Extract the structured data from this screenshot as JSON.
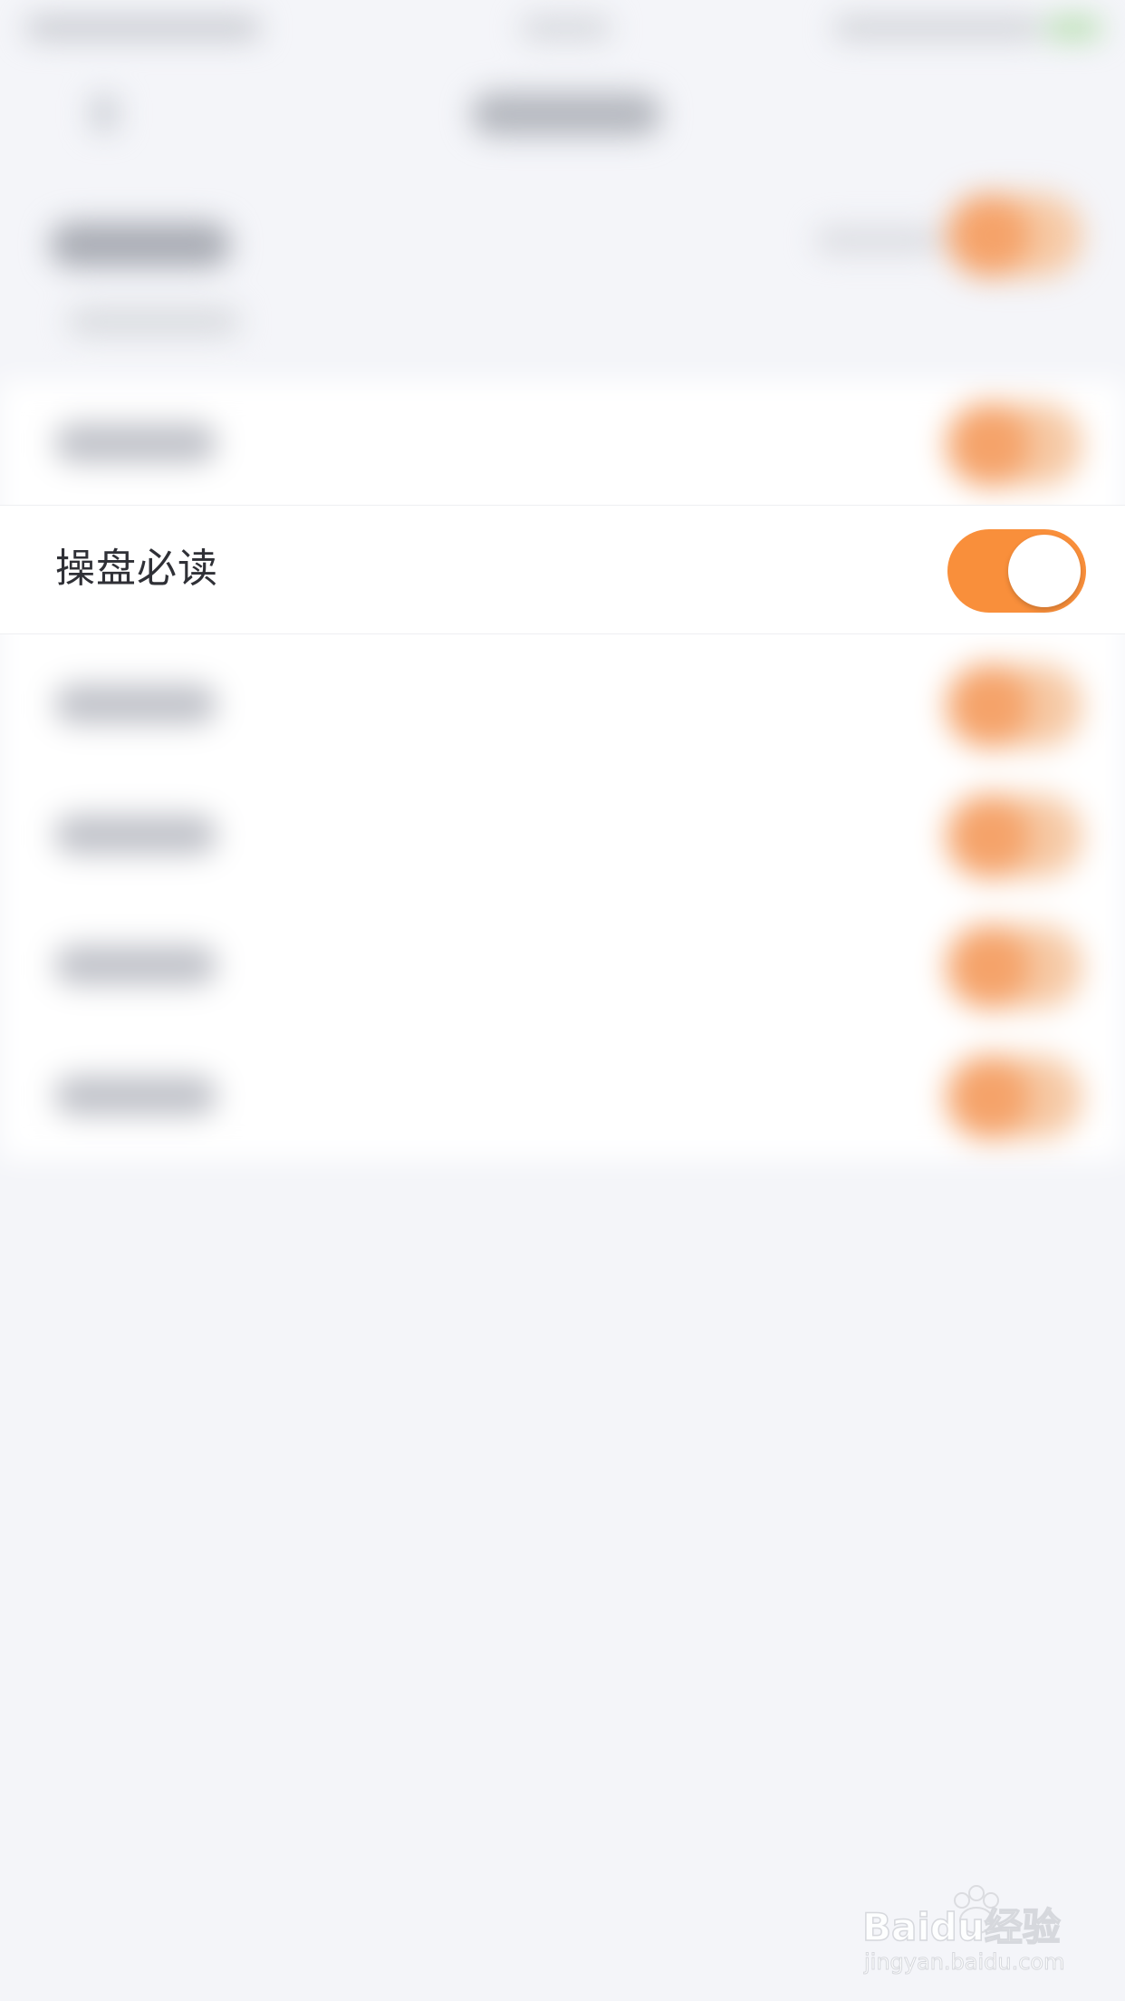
{
  "setting": {
    "label": "操盘必读",
    "toggle_on": true
  },
  "colors": {
    "accent": "#f98f3b",
    "page_background": "#f4f5f9",
    "row_background": "#ffffff",
    "label_text": "#2f3036"
  },
  "watermark": {
    "brand": "Baidu经验",
    "url": "jingyan.baidu.com"
  }
}
